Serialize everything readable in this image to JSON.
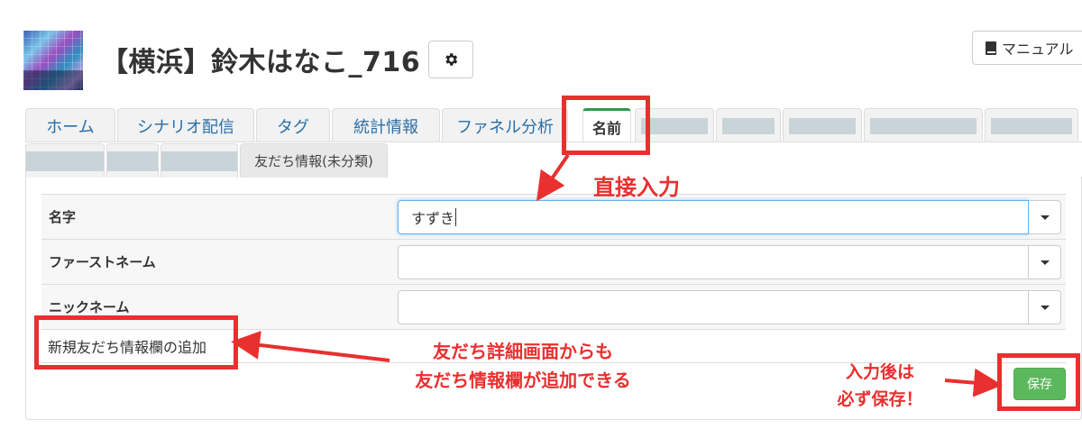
{
  "header": {
    "title": "【横浜】鈴木はなこ_716",
    "manual_label": "マニュアル"
  },
  "tabs": [
    {
      "label": "ホーム"
    },
    {
      "label": "シナリオ配信"
    },
    {
      "label": "タグ"
    },
    {
      "label": "統計情報"
    },
    {
      "label": "ファネル分析"
    },
    {
      "label": "名前",
      "active": true
    }
  ],
  "subtabs": [
    {
      "label": "友だち情報(未分類)",
      "active": true
    }
  ],
  "form": {
    "rows": [
      {
        "label": "名字",
        "value": "すずき"
      },
      {
        "label": "ファーストネーム",
        "value": ""
      },
      {
        "label": "ニックネーム",
        "value": ""
      }
    ],
    "add_link": "新規友だち情報欄の追加",
    "save_label": "保存"
  },
  "annotations": {
    "direct_input": "直接入力",
    "add_note_line1": "友だち詳細画面からも",
    "add_note_line2": "友だち情報欄が追加できる",
    "save_note_line1": "入力後は",
    "save_note_line2": "必ず保存！"
  },
  "colors": {
    "accent_red": "#e8302f",
    "save_green": "#5cb85c",
    "tab_active_green": "#2e9b4a",
    "link_blue": "#2a6fa8"
  }
}
